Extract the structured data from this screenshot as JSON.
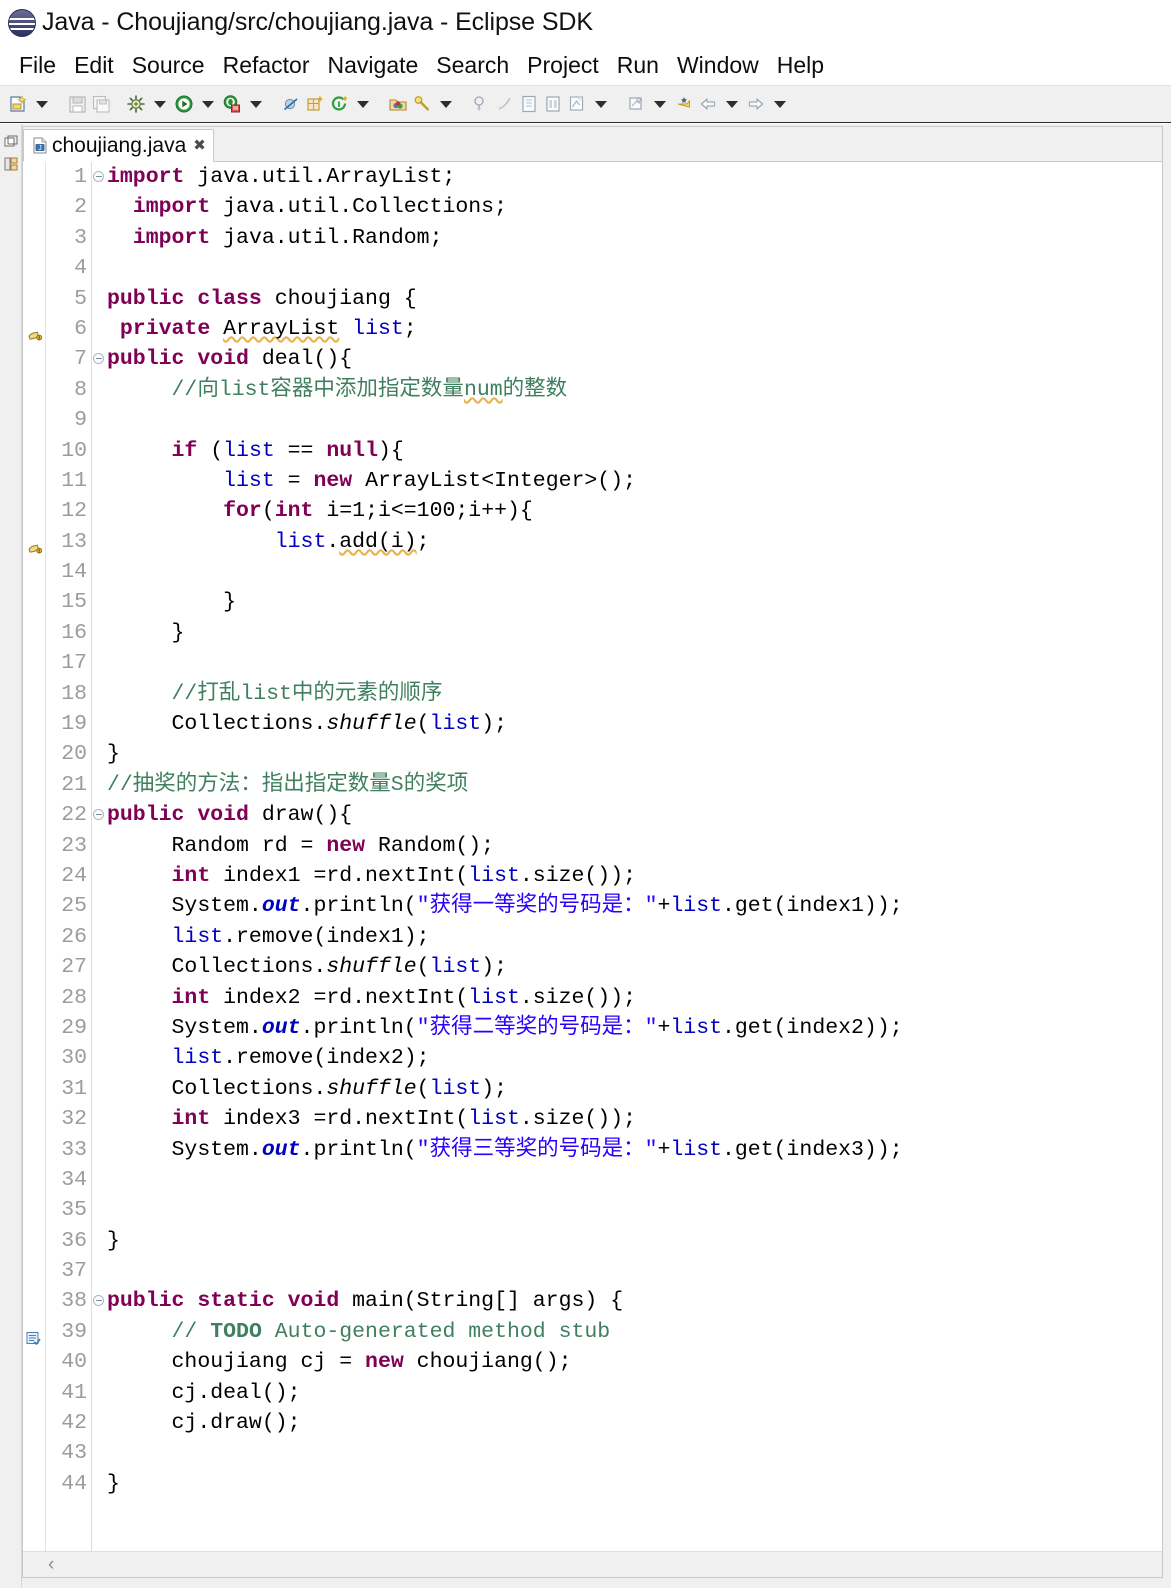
{
  "window": {
    "title": "Java - Choujiang/src/choujiang.java - Eclipse SDK",
    "logo_icon": "eclipse-logo-icon"
  },
  "menubar": {
    "items": [
      {
        "label": "File"
      },
      {
        "label": "Edit"
      },
      {
        "label": "Source"
      },
      {
        "label": "Refactor"
      },
      {
        "label": "Navigate"
      },
      {
        "label": "Search"
      },
      {
        "label": "Project"
      },
      {
        "label": "Run"
      },
      {
        "label": "Window"
      },
      {
        "label": "Help"
      }
    ]
  },
  "toolbar": {
    "items": [
      "new-wizard-icon",
      "dropdown-arrow",
      "separator",
      "save-icon",
      "save-all-icon",
      "separator",
      "build-all-icon",
      "dropdown-arrow",
      "run-icon",
      "dropdown-arrow",
      "debug-icon",
      "dropdown-arrow",
      "separator",
      "skip-breakpoints-icon",
      "new-package-icon",
      "new-annotation-icon",
      "dropdown-arrow",
      "separator",
      "open-type-icon",
      "search-icon",
      "dropdown-arrow",
      "separator",
      "next-annotation-icon",
      "previous-annotation-icon",
      "toggle-block-selection-icon",
      "show-whitespace-icon",
      "toggle-mark-occurrences-icon",
      "dropdown-arrow",
      "separator",
      "last-edit-location-icon",
      "dropdown-arrow",
      "pin-editor-icon",
      "back-icon",
      "dropdown-arrow",
      "forward-icon",
      "dropdown-arrow"
    ]
  },
  "left_bar": {
    "items": [
      {
        "name": "restore-perspective-icon"
      },
      {
        "name": "package-explorer-icon"
      }
    ]
  },
  "editor": {
    "tab": {
      "label": "choujiang.java",
      "close_label": "✖",
      "file_icon": "java-file-icon"
    },
    "hscroll": {
      "left_arrow": "‹"
    },
    "markers": {
      "6": "warning-icon",
      "13": "warning-icon",
      "39": "todo-task-icon"
    },
    "folds": [
      "1",
      "7",
      "22",
      "38"
    ],
    "lines": [
      {
        "n": "1",
        "tokens": [
          {
            "t": "import",
            "c": "kw"
          },
          {
            "t": " java.util.ArrayList;",
            "c": ""
          }
        ]
      },
      {
        "n": "2",
        "tokens": [
          {
            "t": "  ",
            "c": ""
          },
          {
            "t": "import",
            "c": "kw"
          },
          {
            "t": " java.util.Collections;",
            "c": ""
          }
        ]
      },
      {
        "n": "3",
        "tokens": [
          {
            "t": "  ",
            "c": ""
          },
          {
            "t": "import",
            "c": "kw"
          },
          {
            "t": " java.util.Random;",
            "c": ""
          }
        ]
      },
      {
        "n": "4",
        "tokens": []
      },
      {
        "n": "5",
        "tokens": [
          {
            "t": "public class",
            "c": "kw"
          },
          {
            "t": " choujiang {",
            "c": ""
          }
        ]
      },
      {
        "n": "6",
        "tokens": [
          {
            "t": " ",
            "c": ""
          },
          {
            "t": "private",
            "c": "kw"
          },
          {
            "t": " ",
            "c": ""
          },
          {
            "t": "ArrayList",
            "c": "sq"
          },
          {
            "t": " ",
            "c": ""
          },
          {
            "t": "list",
            "c": "fld"
          },
          {
            "t": ";",
            "c": ""
          }
        ]
      },
      {
        "n": "7",
        "tokens": [
          {
            "t": "public void",
            "c": "kw"
          },
          {
            "t": " deal(){",
            "c": ""
          }
        ]
      },
      {
        "n": "8",
        "tokens": [
          {
            "t": "     ",
            "c": ""
          },
          {
            "t": "//向list容器中添加指定数量",
            "c": "cm"
          },
          {
            "t": "num",
            "c": "cm sq"
          },
          {
            "t": "的整数",
            "c": "cm"
          }
        ]
      },
      {
        "n": "9",
        "tokens": []
      },
      {
        "n": "10",
        "tokens": [
          {
            "t": "     ",
            "c": ""
          },
          {
            "t": "if",
            "c": "kw"
          },
          {
            "t": " (",
            "c": ""
          },
          {
            "t": "list",
            "c": "fld"
          },
          {
            "t": " == ",
            "c": ""
          },
          {
            "t": "null",
            "c": "kw"
          },
          {
            "t": "){",
            "c": ""
          }
        ]
      },
      {
        "n": "11",
        "tokens": [
          {
            "t": "         ",
            "c": ""
          },
          {
            "t": "list",
            "c": "fld"
          },
          {
            "t": " = ",
            "c": ""
          },
          {
            "t": "new",
            "c": "kw"
          },
          {
            "t": " ArrayList<Integer>();",
            "c": ""
          }
        ]
      },
      {
        "n": "12",
        "tokens": [
          {
            "t": "         ",
            "c": ""
          },
          {
            "t": "for",
            "c": "kw"
          },
          {
            "t": "(",
            "c": ""
          },
          {
            "t": "int",
            "c": "kw"
          },
          {
            "t": " i=1;i<=100;i++){",
            "c": ""
          }
        ]
      },
      {
        "n": "13",
        "tokens": [
          {
            "t": "             ",
            "c": ""
          },
          {
            "t": "list",
            "c": "fld"
          },
          {
            "t": ".",
            "c": ""
          },
          {
            "t": "add(i)",
            "c": "sq"
          },
          {
            "t": ";",
            "c": ""
          }
        ]
      },
      {
        "n": "14",
        "tokens": []
      },
      {
        "n": "15",
        "tokens": [
          {
            "t": "         }",
            "c": ""
          }
        ]
      },
      {
        "n": "16",
        "tokens": [
          {
            "t": "     }",
            "c": ""
          }
        ]
      },
      {
        "n": "17",
        "tokens": []
      },
      {
        "n": "18",
        "tokens": [
          {
            "t": "     ",
            "c": ""
          },
          {
            "t": "//打乱list中的元素的顺序",
            "c": "cm"
          }
        ]
      },
      {
        "n": "19",
        "tokens": [
          {
            "t": "     Collections.",
            "c": ""
          },
          {
            "t": "shuffle",
            "c": "mth"
          },
          {
            "t": "(",
            "c": ""
          },
          {
            "t": "list",
            "c": "fld"
          },
          {
            "t": ");",
            "c": ""
          }
        ]
      },
      {
        "n": "20",
        "tokens": [
          {
            "t": "}",
            "c": ""
          }
        ]
      },
      {
        "n": "21",
        "tokens": [
          {
            "t": "//抽奖的方法：指出指定数量S的奖项",
            "c": "cm"
          }
        ]
      },
      {
        "n": "22",
        "tokens": [
          {
            "t": "public void",
            "c": "kw"
          },
          {
            "t": " draw(){",
            "c": ""
          }
        ]
      },
      {
        "n": "23",
        "tokens": [
          {
            "t": "     Random rd = ",
            "c": ""
          },
          {
            "t": "new",
            "c": "kw"
          },
          {
            "t": " Random();",
            "c": ""
          }
        ]
      },
      {
        "n": "24",
        "tokens": [
          {
            "t": "     ",
            "c": ""
          },
          {
            "t": "int",
            "c": "kw"
          },
          {
            "t": " index1 =rd.nextInt(",
            "c": ""
          },
          {
            "t": "list",
            "c": "fld"
          },
          {
            "t": ".size());",
            "c": ""
          }
        ]
      },
      {
        "n": "25",
        "tokens": [
          {
            "t": "     System.",
            "c": ""
          },
          {
            "t": "out",
            "c": "stat"
          },
          {
            "t": ".println(",
            "c": ""
          },
          {
            "t": "\"获得一等奖的号码是：\"",
            "c": "str"
          },
          {
            "t": "+",
            "c": ""
          },
          {
            "t": "list",
            "c": "fld"
          },
          {
            "t": ".get(index1));",
            "c": ""
          }
        ]
      },
      {
        "n": "26",
        "tokens": [
          {
            "t": "     ",
            "c": ""
          },
          {
            "t": "list",
            "c": "fld"
          },
          {
            "t": ".remove(index1);",
            "c": ""
          }
        ]
      },
      {
        "n": "27",
        "tokens": [
          {
            "t": "     Collections.",
            "c": ""
          },
          {
            "t": "shuffle",
            "c": "mth"
          },
          {
            "t": "(",
            "c": ""
          },
          {
            "t": "list",
            "c": "fld"
          },
          {
            "t": ");",
            "c": ""
          }
        ]
      },
      {
        "n": "28",
        "tokens": [
          {
            "t": "     ",
            "c": ""
          },
          {
            "t": "int",
            "c": "kw"
          },
          {
            "t": " index2 =rd.nextInt(",
            "c": ""
          },
          {
            "t": "list",
            "c": "fld"
          },
          {
            "t": ".size());",
            "c": ""
          }
        ]
      },
      {
        "n": "29",
        "tokens": [
          {
            "t": "     System.",
            "c": ""
          },
          {
            "t": "out",
            "c": "stat"
          },
          {
            "t": ".println(",
            "c": ""
          },
          {
            "t": "\"获得二等奖的号码是：\"",
            "c": "str"
          },
          {
            "t": "+",
            "c": ""
          },
          {
            "t": "list",
            "c": "fld"
          },
          {
            "t": ".get(index2));",
            "c": ""
          }
        ]
      },
      {
        "n": "30",
        "tokens": [
          {
            "t": "     ",
            "c": ""
          },
          {
            "t": "list",
            "c": "fld"
          },
          {
            "t": ".remove(index2);",
            "c": ""
          }
        ]
      },
      {
        "n": "31",
        "tokens": [
          {
            "t": "     Collections.",
            "c": ""
          },
          {
            "t": "shuffle",
            "c": "mth"
          },
          {
            "t": "(",
            "c": ""
          },
          {
            "t": "list",
            "c": "fld"
          },
          {
            "t": ");",
            "c": ""
          }
        ]
      },
      {
        "n": "32",
        "tokens": [
          {
            "t": "     ",
            "c": ""
          },
          {
            "t": "int",
            "c": "kw"
          },
          {
            "t": " index3 =rd.nextInt(",
            "c": ""
          },
          {
            "t": "list",
            "c": "fld"
          },
          {
            "t": ".size());",
            "c": ""
          }
        ]
      },
      {
        "n": "33",
        "tokens": [
          {
            "t": "     System.",
            "c": ""
          },
          {
            "t": "out",
            "c": "stat"
          },
          {
            "t": ".println(",
            "c": ""
          },
          {
            "t": "\"获得三等奖的号码是：\"",
            "c": "str"
          },
          {
            "t": "+",
            "c": ""
          },
          {
            "t": "list",
            "c": "fld"
          },
          {
            "t": ".get(index3));",
            "c": ""
          }
        ]
      },
      {
        "n": "34",
        "tokens": []
      },
      {
        "n": "35",
        "tokens": []
      },
      {
        "n": "36",
        "tokens": [
          {
            "t": "}",
            "c": ""
          }
        ]
      },
      {
        "n": "37",
        "tokens": []
      },
      {
        "n": "38",
        "tokens": [
          {
            "t": "public static void",
            "c": "kw"
          },
          {
            "t": " main(String[] args) {",
            "c": ""
          }
        ]
      },
      {
        "n": "39",
        "tokens": [
          {
            "t": "     ",
            "c": ""
          },
          {
            "t": "// ",
            "c": "cm"
          },
          {
            "t": "TODO",
            "c": "todo"
          },
          {
            "t": " Auto-generated method stub",
            "c": "cm"
          }
        ]
      },
      {
        "n": "40",
        "tokens": [
          {
            "t": "     choujiang cj = ",
            "c": ""
          },
          {
            "t": "new",
            "c": "kw"
          },
          {
            "t": " choujiang();",
            "c": ""
          }
        ]
      },
      {
        "n": "41",
        "tokens": [
          {
            "t": "     cj.deal();",
            "c": ""
          }
        ]
      },
      {
        "n": "42",
        "tokens": [
          {
            "t": "     cj.draw();",
            "c": ""
          }
        ]
      },
      {
        "n": "43",
        "tokens": []
      },
      {
        "n": "44",
        "tokens": [
          {
            "t": "}",
            "c": ""
          }
        ]
      }
    ]
  },
  "colors": {
    "keyword": "#7f0055",
    "comment": "#3f7f5f",
    "string": "#2a00ff",
    "field": "#0000c0",
    "line_number": "#9c9c9c",
    "toolbar_bg": "#f0f0f0",
    "editor_bg": "#ffffff"
  }
}
